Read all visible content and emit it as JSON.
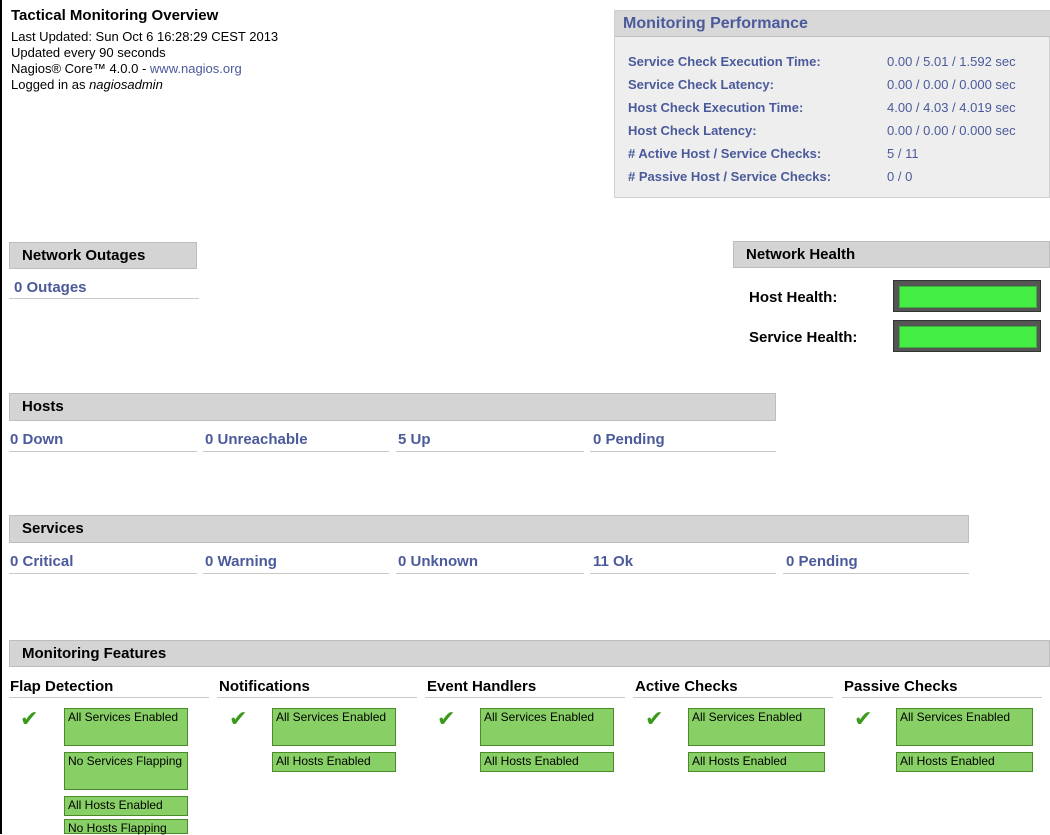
{
  "info": {
    "title": "Tactical Monitoring Overview",
    "last_updated": "Last Updated: Sun Oct 6 16:28:29 CEST 2013",
    "update_interval": "Updated every 90 seconds",
    "version_prefix": "Nagios® Core™ 4.0.0 - ",
    "website": "www.nagios.org",
    "logged_in_prefix": "Logged in as ",
    "user": "nagiosadmin"
  },
  "monitoring_performance": {
    "title": "Monitoring Performance",
    "rows": [
      {
        "label": "Service Check Execution Time:",
        "value": "0.00 / 5.01 / 1.592 sec"
      },
      {
        "label": "Service Check Latency:",
        "value": "0.00 / 0.00 / 0.000 sec"
      },
      {
        "label": "Host Check Execution Time:",
        "value": "4.00 / 4.03 / 4.019 sec"
      },
      {
        "label": "Host Check Latency:",
        "value": "0.00 / 0.00 / 0.000 sec"
      },
      {
        "label": "# Active Host / Service Checks:",
        "value": "5 / 11"
      },
      {
        "label": "# Passive Host / Service Checks:",
        "value": "0 / 0"
      }
    ]
  },
  "network_outages": {
    "title": "Network Outages",
    "count": "0 Outages"
  },
  "network_health": {
    "title": "Network Health",
    "host_label": "Host Health:",
    "service_label": "Service Health:",
    "host_health_fraction": 1.0,
    "service_health_fraction": 1.0,
    "bar_color": "#44ee44"
  },
  "hosts": {
    "title": "Hosts",
    "stats": [
      "0 Down",
      "0 Unreachable",
      "5 Up",
      "0 Pending"
    ]
  },
  "services": {
    "title": "Services",
    "stats": [
      "0 Critical",
      "0 Warning",
      "0 Unknown",
      "11 Ok",
      "0 Pending"
    ]
  },
  "features": {
    "title": "Monitoring Features",
    "check_icon": "green-check-icon",
    "columns": [
      {
        "title": "Flap Detection",
        "items": [
          "All Services Enabled",
          "No Services Flapping",
          "All Hosts Enabled",
          "No Hosts Flapping"
        ]
      },
      {
        "title": "Notifications",
        "items": [
          "All Services Enabled",
          "All Hosts Enabled"
        ]
      },
      {
        "title": "Event Handlers",
        "items": [
          "All Services Enabled",
          "All Hosts Enabled"
        ]
      },
      {
        "title": "Active Checks",
        "items": [
          "All Services Enabled",
          "All Hosts Enabled"
        ]
      },
      {
        "title": "Passive Checks",
        "items": [
          "All Services Enabled",
          "All Hosts Enabled"
        ]
      }
    ]
  },
  "colors": {
    "link": "#4b5a9b",
    "header_bg": "#d4d4d4",
    "enabled_bg": "#88d066"
  }
}
